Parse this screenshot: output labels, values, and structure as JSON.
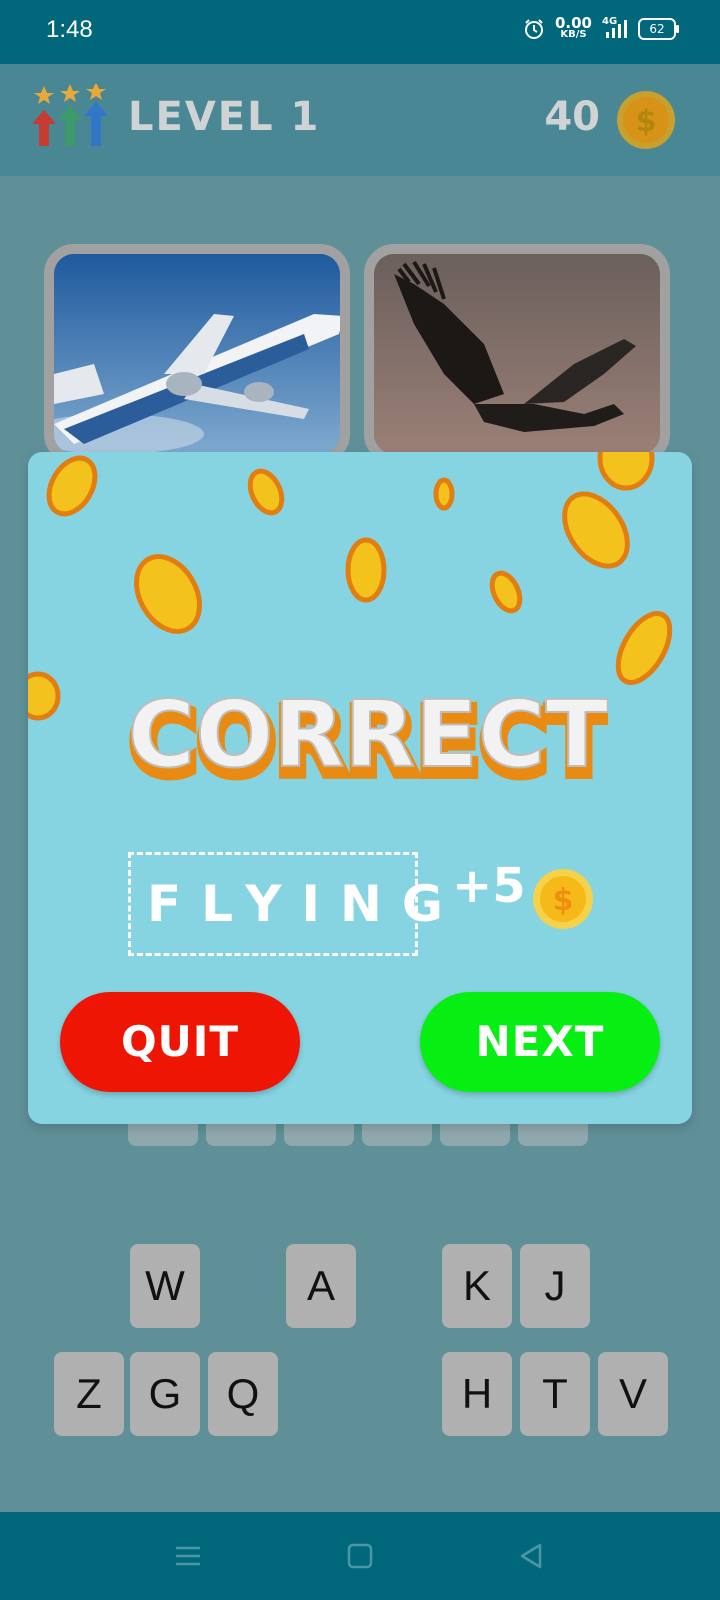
{
  "status_bar": {
    "time": "1:48",
    "net_speed_value": "0.00",
    "net_speed_unit": "KB/S",
    "network_type": "4G",
    "battery": "62"
  },
  "header": {
    "level_label": "LEVEL 1",
    "coins": "40"
  },
  "puzzle": {
    "images": [
      "airplane-photo",
      "bird-photo"
    ]
  },
  "keyboard": {
    "row1": [
      "W",
      "A",
      "K",
      "J"
    ],
    "row2": [
      "Z",
      "G",
      "Q",
      "H",
      "T",
      "V"
    ]
  },
  "popup": {
    "title": "CORRECT",
    "answer": "FLYING",
    "reward": "+5",
    "quit_label": "QUIT",
    "next_label": "NEXT"
  },
  "colors": {
    "status_bar": "#01687b",
    "header": "#4a8794",
    "popup_bg": "#86d4e2",
    "quit": "#ef1505",
    "next": "#06ee12",
    "coin": "#f6b91a"
  }
}
